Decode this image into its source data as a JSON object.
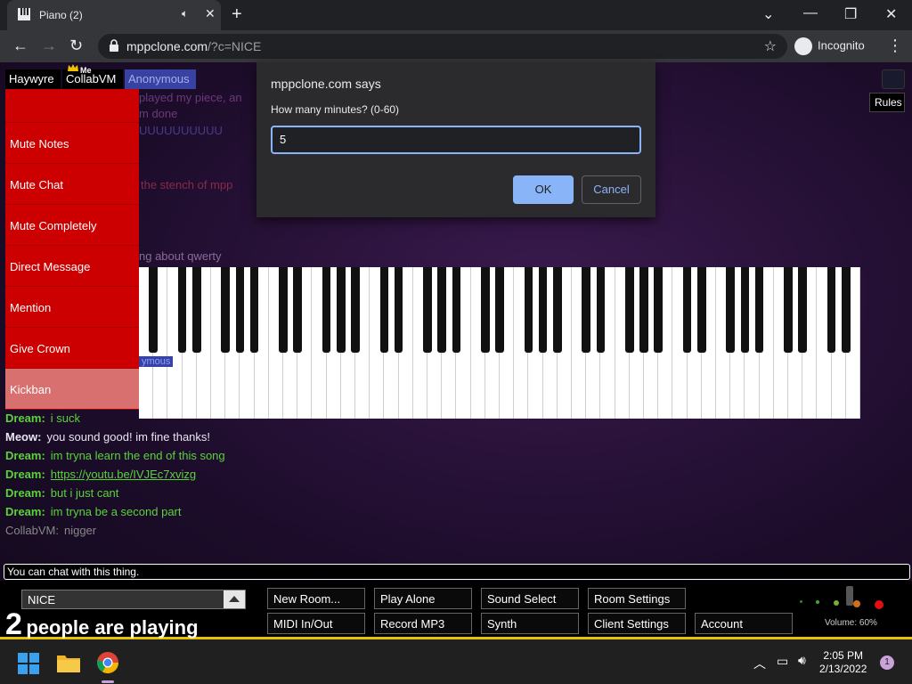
{
  "browser": {
    "tab_title": "Piano (2)",
    "audio_icon": "speaker-icon",
    "new_tab_label": "+",
    "url_domain": "mppclone.com",
    "url_path": "/?c=NICE",
    "incognito_label": "Incognito"
  },
  "participants": [
    {
      "name": "Haywyre"
    },
    {
      "name": "CollabVM",
      "badge": "Me"
    },
    {
      "name": "Anonymous"
    }
  ],
  "context_menu": {
    "items": [
      "Mute Notes",
      "Mute Chat",
      "Mute Completely",
      "Direct Message",
      "Mention",
      "Give Crown",
      "Kickban"
    ]
  },
  "ghost_text": {
    "line1": "played my piece, an",
    "line2": "m done",
    "line3": "UUUUUUUUUU",
    "line4": "the stench of mpp",
    "line5": "ng about qwerty",
    "line6": "ymous"
  },
  "chat": [
    {
      "who": "Dream:",
      "text": "i suck",
      "style": "green"
    },
    {
      "who": "Meow:",
      "text": "you sound good! im fine thanks!",
      "style": "meow"
    },
    {
      "who": "Dream:",
      "text": "im tryna learn the end of this song",
      "style": "green"
    },
    {
      "who": "Dream:",
      "text": "https://youtu.be/IVJEc7xvizg",
      "style": "green-link"
    },
    {
      "who": "Dream:",
      "text": "but i just cant",
      "style": "green"
    },
    {
      "who": "Dream:",
      "text": "im tryna be a second part",
      "style": "green"
    },
    {
      "who": "CollabVM:",
      "text": "nigger",
      "style": "dim"
    }
  ],
  "chat_input": {
    "placeholder": "You can chat with this thing."
  },
  "bottom_bar": {
    "room_name": "NICE",
    "player_count": "2",
    "players_label": "people are playing",
    "buttons_row1": [
      "New Room...",
      "Play Alone",
      "Sound Select",
      "Room Settings"
    ],
    "buttons_row2": [
      "MIDI In/Out",
      "Record MP3",
      "Synth",
      "Client Settings",
      "Account"
    ],
    "volume_label": "Volume: 60%",
    "volume_level": 0.6
  },
  "rules_label": "Rules",
  "dialog": {
    "title": "mppclone.com says",
    "prompt": "How many minutes? (0-60)",
    "value": "5",
    "ok_label": "OK",
    "cancel_label": "Cancel"
  },
  "taskbar": {
    "time": "2:05 PM",
    "date": "2/13/2022",
    "notifications": "1"
  },
  "colors": {
    "menu_red": "#cc0000",
    "chat_green": "#5ad33a",
    "accent_blue": "#8ab4f8",
    "bottom_border": "#e7c200"
  }
}
